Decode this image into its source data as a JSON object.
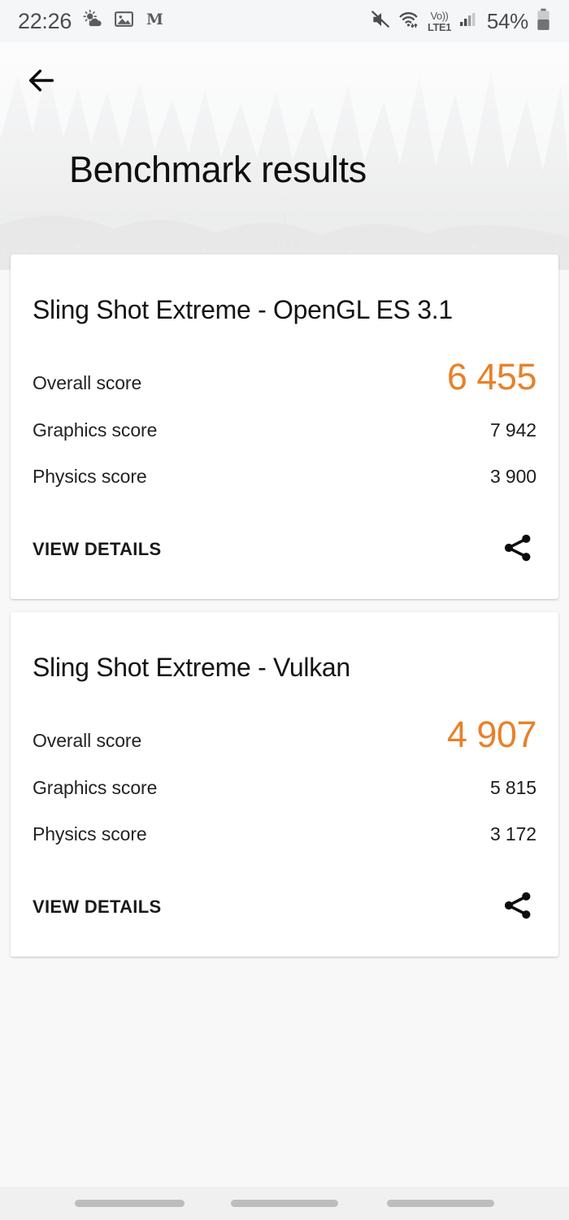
{
  "status_bar": {
    "clock": "22:26",
    "battery_percent": "54%",
    "network_label_top": "Vo))",
    "network_label_bottom": "LTE1",
    "icons": [
      "weather-partly-cloudy-icon",
      "image-gallery-icon",
      "gothic-m-app-icon",
      "mute-icon",
      "wifi-icon",
      "volte-icon",
      "cellular-signal-icon",
      "battery-icon"
    ]
  },
  "header": {
    "title": "Benchmark results",
    "back_icon": "back-arrow-icon"
  },
  "cards": [
    {
      "title": "Sling Shot Extreme - OpenGL ES 3.1",
      "overall_label": "Overall score",
      "overall_value": "6 455",
      "rows": [
        {
          "label": "Graphics score",
          "value": "7 942"
        },
        {
          "label": "Physics score",
          "value": "3 900"
        }
      ],
      "view_details_label": "VIEW DETAILS",
      "share_icon": "share-icon"
    },
    {
      "title": "Sling Shot Extreme - Vulkan",
      "overall_label": "Overall score",
      "overall_value": "4 907",
      "rows": [
        {
          "label": "Graphics score",
          "value": "5 815"
        },
        {
          "label": "Physics score",
          "value": "3 172"
        }
      ],
      "view_details_label": "VIEW DETAILS",
      "share_icon": "share-icon"
    }
  ],
  "colors": {
    "accent_orange": "#e8812a",
    "page_background": "#f8f8f8",
    "card_background": "#ffffff",
    "text_primary": "#141414"
  },
  "nav_bar": {
    "pills": [
      "recents-pill",
      "home-pill",
      "back-pill"
    ]
  }
}
